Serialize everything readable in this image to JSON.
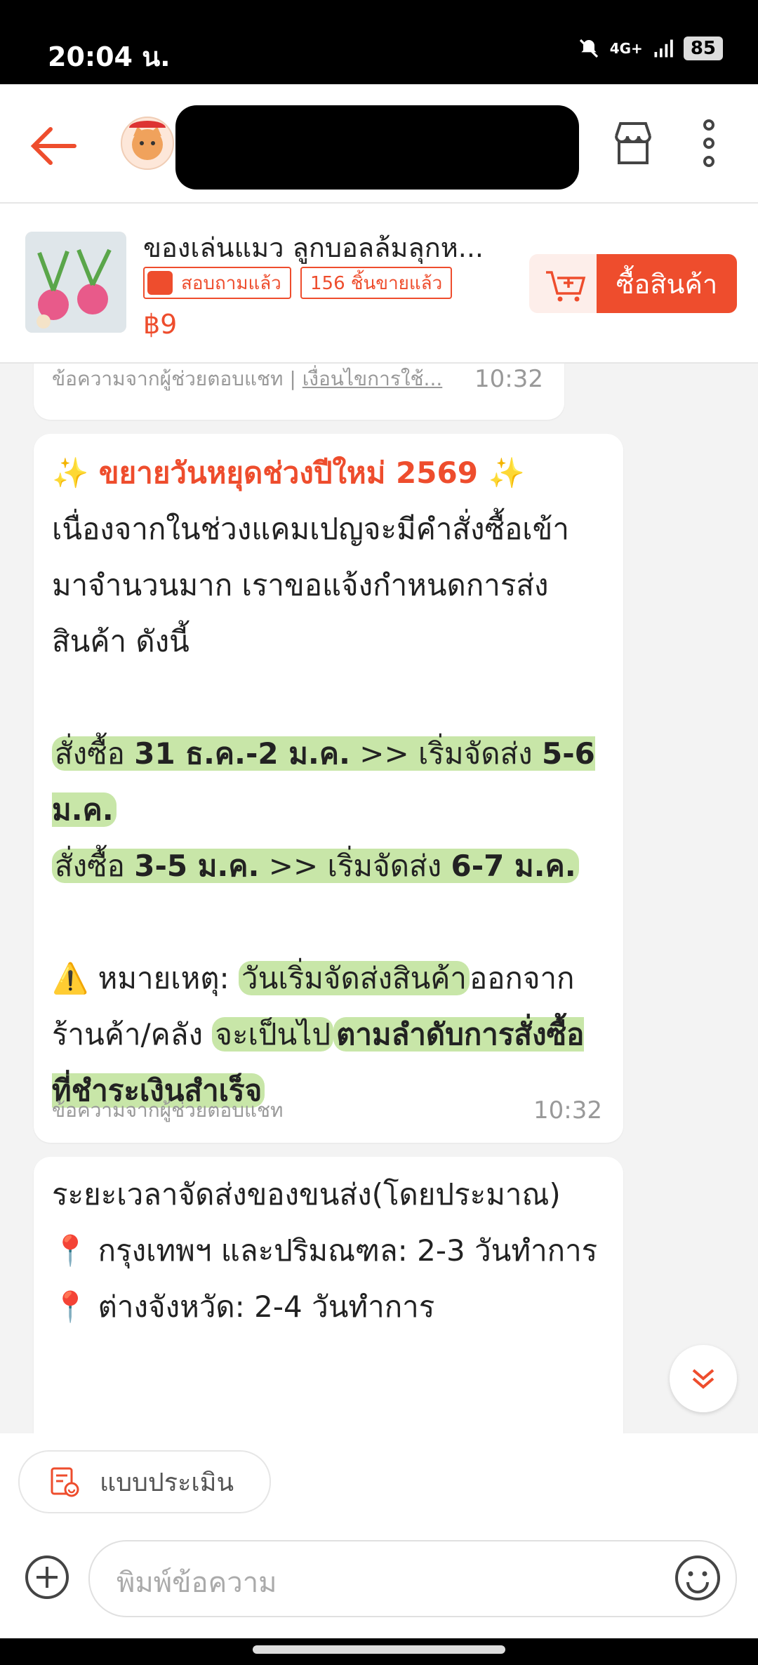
{
  "status_bar": {
    "time": "20:04 น.",
    "network": "4G+",
    "battery": "85"
  },
  "header": {
    "back_icon": "arrow-left-icon",
    "shop_name": "",
    "store_icon": "store-icon",
    "more_icon": "more-vertical-icon"
  },
  "product": {
    "title": "ของเล่นแมว ลูกบอลล้มลุกห...",
    "asked_label": "สอบถามแล้ว",
    "sold_label": "156 ชิ้นขายแล้ว",
    "price": "฿9",
    "buy_label": "ซื้อสินค้า",
    "cart_icon": "add-to-cart-icon",
    "accent_color": "#ee4d2d"
  },
  "messages": [
    {
      "source": "ข้อความจากผู้ช่วยตอบแชท | ",
      "source_link": "เงื่อนไขการใช้...",
      "time": "10:32"
    },
    {
      "title": "✨ ขยายวันหยุดช่วงปีใหม่ 2569 ✨",
      "intro": "เนื่องจากในช่วงแคมเปญจะมีคำสั่งซื้อเข้ามาจำนวนมาก เราขอแจ้งกำหนดการส่งสินค้า ดังนี้",
      "s1_a": "สั่งซื้อ ",
      "s1_b": "31 ธ.ค.-2 ม.ค.",
      "s1_c": " >> เริ่มจัดส่ง ",
      "s1_d": "5-6 ม.ค.",
      "s2_a": "สั่งซื้อ ",
      "s2_b": "3-5 ม.ค.",
      "s2_c": " >> เริ่มจัดส่ง ",
      "s2_d": "6-7 ม.ค.",
      "n_a": "⚠️ หมายเหตุ: ",
      "n_b": "วันเริ่มจัดส่งสินค้า",
      "n_c": "ออกจากร้านค้า/คลัง ",
      "n_d": "จะเป็นไป",
      "n_e": "ตามลำดับการสั่งซื้อที่ชำระเงินสำเร็จ",
      "source": "ข้อความจากผู้ช่วยตอบแชท",
      "time": "10:32"
    },
    {
      "l1": "ระยะเวลาจัดส่งของขนส่ง(โดยประมาณ)",
      "l2": "📍 กรุงเทพฯ และปริมณฑล: 2-3 วันทำการ",
      "l3": "📍 ต่างจังหวัด: 2-4 วันทำการ"
    }
  ],
  "bottom": {
    "eval_label": "แบบประเมิน",
    "input_placeholder": "พิมพ์ข้อความ",
    "add_icon": "plus-circle-icon",
    "emoji_icon": "smiley-icon"
  }
}
